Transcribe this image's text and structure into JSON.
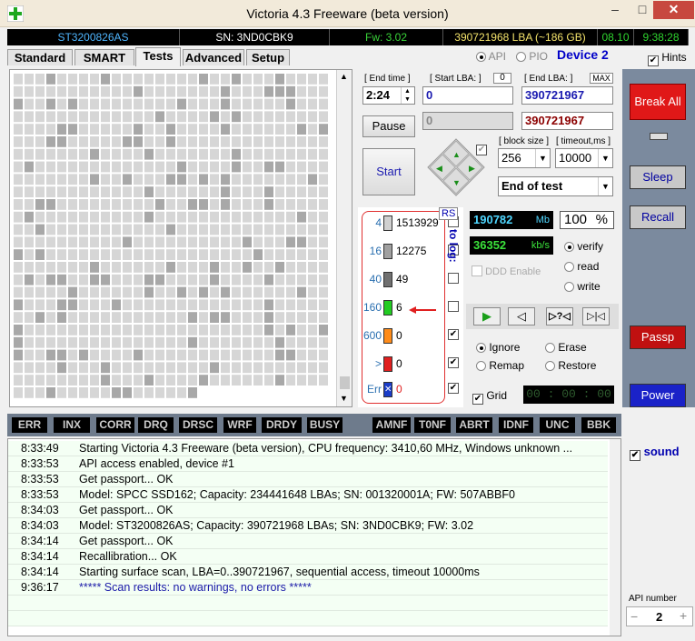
{
  "window": {
    "title": "Victoria 4.3 Freeware (beta version)",
    "min": "–",
    "max": "□",
    "close": "✕"
  },
  "infobar": {
    "model": "ST3200826AS",
    "sn": "SN: 3ND0CBK9",
    "fw": "Fw: 3.02",
    "lba": "390721968 LBA (~186 GB)",
    "date": "08.10",
    "time": "9:38:28"
  },
  "tabs": [
    "Standard",
    "SMART",
    "Tests",
    "Advanced",
    "Setup"
  ],
  "active_tab": "Tests",
  "mode": {
    "api": "API",
    "pio": "PIO",
    "device": "Device 2",
    "hints": "Hints"
  },
  "controls": {
    "end_time_label": "[ End time ]",
    "end_time_value": "2:24",
    "start_lba_label": "[ Start LBA: ]",
    "start_lba_zero": "0",
    "start_lba_value": "0",
    "start_lba_current": "0",
    "end_lba_label": "[ End LBA: ]",
    "end_lba_max": "MAX",
    "end_lba_value": "390721967",
    "end_lba_current": "390721967",
    "pause": "Pause",
    "start": "Start",
    "block_size_label": "[ block size ]",
    "block_size": "256",
    "timeout_label": "[ timeout,ms ]",
    "timeout": "10000",
    "end_action": "End of test"
  },
  "stats": {
    "rs": "RS",
    "to_log": "to log:",
    "rows": [
      {
        "threshold": "4",
        "count": "1513929",
        "color": "#d0d0d0",
        "log": false
      },
      {
        "threshold": "16",
        "count": "12275",
        "color": "#a0a0a0",
        "log": false
      },
      {
        "threshold": "40",
        "count": "49",
        "color": "#707070",
        "log": false
      },
      {
        "threshold": "160",
        "count": "6",
        "color": "#22cc22",
        "log": false
      },
      {
        "threshold": "600",
        "count": "0",
        "color": "#ff8c1a",
        "log": true
      },
      {
        "threshold": ">",
        "count": "0",
        "color": "#e02020",
        "log": true
      },
      {
        "threshold": "Err",
        "count": "0",
        "color": "#1a3cc8",
        "log": true
      }
    ]
  },
  "speed": {
    "mb": "190782",
    "mb_unit": "Mb",
    "percent": "100",
    "percent_unit": "%",
    "kbs": "36352",
    "kbs_unit": "kb/s",
    "verify": "verify",
    "read": "read",
    "write": "write",
    "ddd": "DDD Enable",
    "ignore": "Ignore",
    "erase": "Erase",
    "remap": "Remap",
    "restore": "Restore",
    "grid": "Grid",
    "timer": "00 : 00 : 00"
  },
  "right_buttons": {
    "break_all": "Break All",
    "sleep": "Sleep",
    "recall": "Recall",
    "passp": "Passp",
    "power": "Power",
    "sound": "sound",
    "api_number_label": "API number",
    "api_number": "2"
  },
  "status_flags": [
    "ERR",
    "INX",
    "CORR",
    "DRQ",
    "DRSC",
    "WRF",
    "DRDY",
    "BUSY",
    "AMNF",
    "T0NF",
    "ABRT",
    "IDNF",
    "UNC",
    "BBK"
  ],
  "log": [
    {
      "time": "8:33:49",
      "msg": "Starting Victoria 4.3 Freeware (beta version), CPU frequency: 3410,60 MHz, Windows unknown ...",
      "color": "#000"
    },
    {
      "time": "8:33:53",
      "msg": "API access enabled, device #1",
      "color": "#000"
    },
    {
      "time": "8:33:53",
      "msg": "Get passport... OK",
      "color": "#000"
    },
    {
      "time": "8:33:53",
      "msg": "Model: SPCC SSD162; Capacity: 234441648 LBAs; SN: 001320001A; FW: 507ABBF0",
      "color": "#000"
    },
    {
      "time": "8:34:03",
      "msg": "Get passport... OK",
      "color": "#000"
    },
    {
      "time": "8:34:03",
      "msg": "Model: ST3200826AS; Capacity: 390721968 LBAs; SN: 3ND0CBK9; FW: 3.02",
      "color": "#000"
    },
    {
      "time": "8:34:14",
      "msg": "Get passport... OK",
      "color": "#000"
    },
    {
      "time": "8:34:14",
      "msg": "Recallibration... OK",
      "color": "#000"
    },
    {
      "time": "8:34:14",
      "msg": "Starting surface scan, LBA=0..390721967, sequential access, timeout 10000ms",
      "color": "#000"
    },
    {
      "time": "9:36:17",
      "msg": "***** Scan results: no warnings, no errors *****",
      "color": "#1a1aa8"
    }
  ]
}
